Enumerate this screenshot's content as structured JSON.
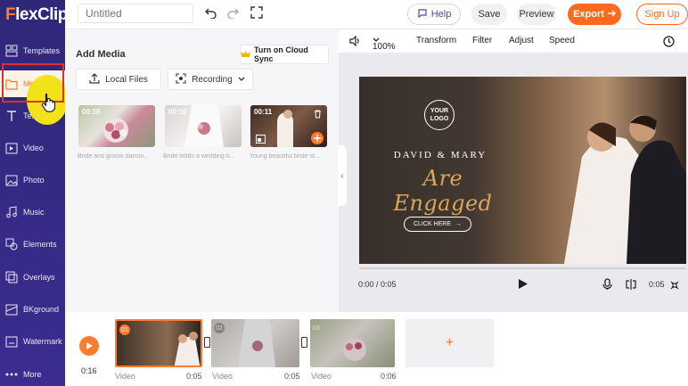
{
  "app": {
    "logo_text_f": "F",
    "logo_text_rest": "lexClip",
    "accent": "#ff6a1f",
    "sidebar_color": "#2f2778"
  },
  "sidebar": {
    "items": [
      {
        "label": "Templates",
        "icon": "templates-icon"
      },
      {
        "label": "Media",
        "icon": "media-folder-icon",
        "active": true
      },
      {
        "label": "Text",
        "icon": "text-icon"
      },
      {
        "label": "Video",
        "icon": "video-icon"
      },
      {
        "label": "Photo",
        "icon": "photo-icon"
      },
      {
        "label": "Music",
        "icon": "music-icon"
      },
      {
        "label": "Elements",
        "icon": "elements-icon"
      },
      {
        "label": "Overlays",
        "icon": "overlays-icon"
      },
      {
        "label": "BKground",
        "icon": "background-icon"
      },
      {
        "label": "Watermark",
        "icon": "watermark-icon"
      },
      {
        "label": "More",
        "icon": "more-icon"
      }
    ]
  },
  "topbar": {
    "title_placeholder": "Untitled",
    "help": "Help",
    "save": "Save",
    "preview": "Preview",
    "export": "Export",
    "signup": "Sign Up"
  },
  "panel": {
    "title": "Add Media",
    "cloud_sync": "Turn on Cloud Sync",
    "local_files": "Local Files",
    "recording": "Recording",
    "media": [
      {
        "duration": "00:18",
        "caption": "Bride and groom dancin..."
      },
      {
        "duration": "00:10",
        "caption": "Bride holds a wedding b..."
      },
      {
        "duration": "00:11",
        "caption": "Young beautiful bride st..."
      }
    ]
  },
  "preview": {
    "zoom": "100%",
    "tools": [
      "Transform",
      "Filter",
      "Adjust",
      "Speed"
    ],
    "canvas_logo": "YOUR LOGO",
    "canvas_names": "DAVID & MARY",
    "canvas_headline": "Are Engaged",
    "canvas_cta": "CLICK HERE",
    "time": "0:00 / 0:05",
    "duration": "0:05"
  },
  "timeline": {
    "time": "0:16",
    "clips": [
      {
        "num": "01",
        "type": "Video",
        "duration": "0:05",
        "selected": true
      },
      {
        "num": "02",
        "type": "Video",
        "duration": "0:05",
        "selected": false
      },
      {
        "num": "03",
        "type": "Video",
        "duration": "0:06",
        "selected": false
      }
    ]
  }
}
